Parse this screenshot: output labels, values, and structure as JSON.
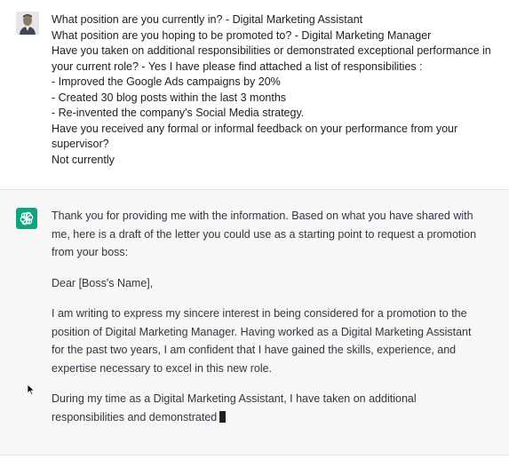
{
  "user_message": {
    "lines": [
      "What position are you currently in? - Digital Marketing Assistant",
      "What position are you hoping to be promoted to? - Digital Marketing Manager",
      "Have you taken on additional responsibilities or demonstrated exceptional performance in your current role? - Yes I have please find attached a list of responsibilities :",
      "- Improved the Google Ads campaigns by 20%",
      "- Created 30 blog posts within the last 3 months",
      "- Re-invented the company's Social Media strategy.",
      "Have you received any formal or informal feedback on your performance from your supervisor?",
      "Not currently"
    ]
  },
  "assistant_message": {
    "intro": "Thank you for providing me with the information. Based on what you have shared with me, here is a draft of the letter you could use as a starting point to request a promotion from your boss:",
    "salutation": "Dear [Boss's Name],",
    "paragraph1": "I am writing to express my sincere interest in being considered for a promotion to the position of Digital Marketing Manager. Having worked as a Digital Marketing Assistant for the past two years, I am confident that I have gained the skills, experience, and expertise necessary to excel in this new role.",
    "paragraph2": "During my time as a Digital Marketing Assistant, I have taken on additional responsibilities and demonstrated"
  },
  "colors": {
    "assistant_bg": "#f7f7f8",
    "gpt_brand": "#10a37f"
  }
}
